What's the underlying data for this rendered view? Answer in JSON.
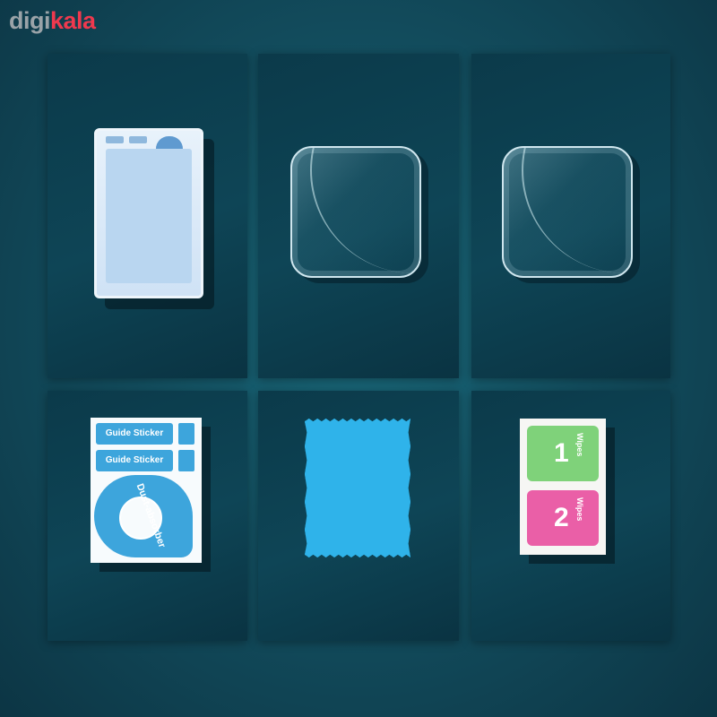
{
  "brand": {
    "part1": "digi",
    "part2": "kala",
    "color1": "#9aa3a8",
    "color2": "#ef394e"
  },
  "background": "#134f60",
  "panels": [
    {
      "id": "storage-box"
    },
    {
      "id": "screen-protector-1"
    },
    {
      "id": "screen-protector-2"
    },
    {
      "id": "guide-sticker-sheet",
      "stickers": [
        "Guide Sticker",
        "Guide Sticker"
      ],
      "dust_label": "Dust-absorber"
    },
    {
      "id": "microfiber-cloth",
      "color": "#2fb3ea"
    },
    {
      "id": "cleaning-wipes",
      "wipes": [
        {
          "number": "1",
          "label": "Wipes",
          "color": "#7fd27a"
        },
        {
          "number": "2",
          "label": "Wipes",
          "color": "#ea5fa7"
        }
      ]
    }
  ]
}
